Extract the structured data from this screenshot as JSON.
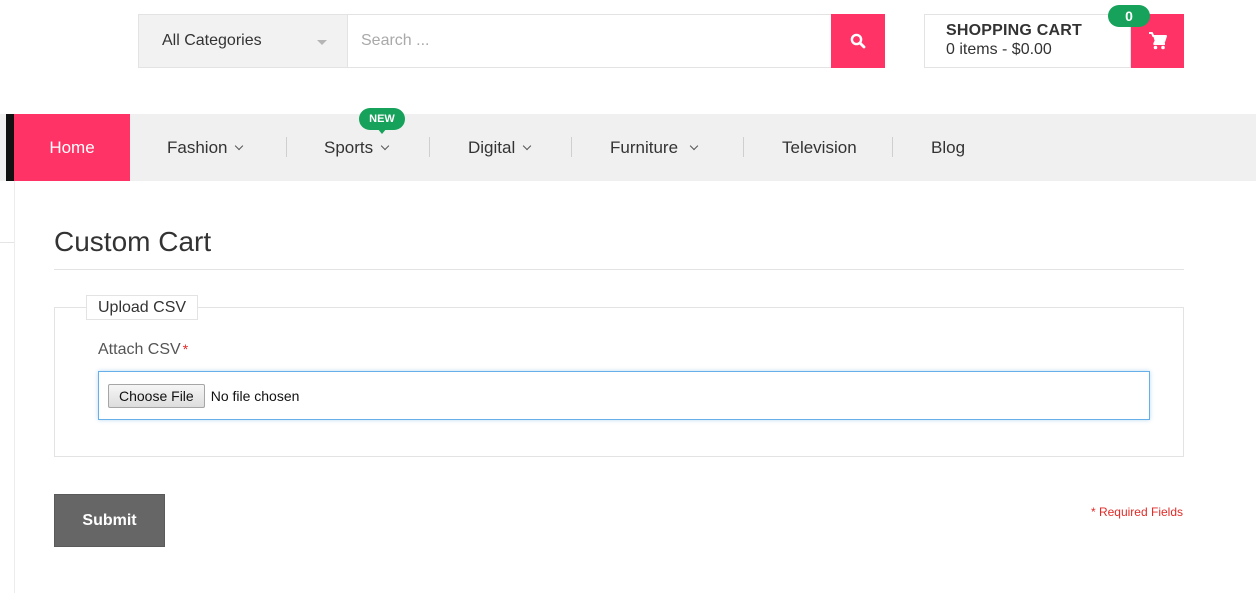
{
  "header": {
    "category": {
      "selected": "All Categories"
    },
    "search": {
      "placeholder": "Search ..."
    }
  },
  "cart": {
    "title": "SHOPPING CART",
    "summary": "0 items - $0.00",
    "badge_count": "0"
  },
  "nav": {
    "home": "Home",
    "items": [
      {
        "label": "Fashion",
        "has_dropdown": true
      },
      {
        "label": "Sports",
        "has_dropdown": true,
        "badge": "NEW"
      },
      {
        "label": "Digital",
        "has_dropdown": true
      },
      {
        "label": "Furniture",
        "has_dropdown": true
      },
      {
        "label": "Television",
        "has_dropdown": false
      },
      {
        "label": "Blog",
        "has_dropdown": false
      }
    ]
  },
  "page": {
    "title": "Custom Cart",
    "fieldset_legend": "Upload CSV",
    "attach_label": "Attach CSV",
    "required_mark": "*",
    "file_button": "Choose File",
    "file_status": "No file chosen",
    "submit_label": "Submit",
    "required_note": "* Required Fields"
  },
  "icons": {
    "search": "search-icon",
    "cart": "cart-icon",
    "caret": "caret-down-icon",
    "chevron": "chevron-down-icon"
  },
  "colors": {
    "accent": "#ff3366",
    "badge": "#16a25a",
    "submit": "#666666",
    "required": "#e02b27"
  }
}
